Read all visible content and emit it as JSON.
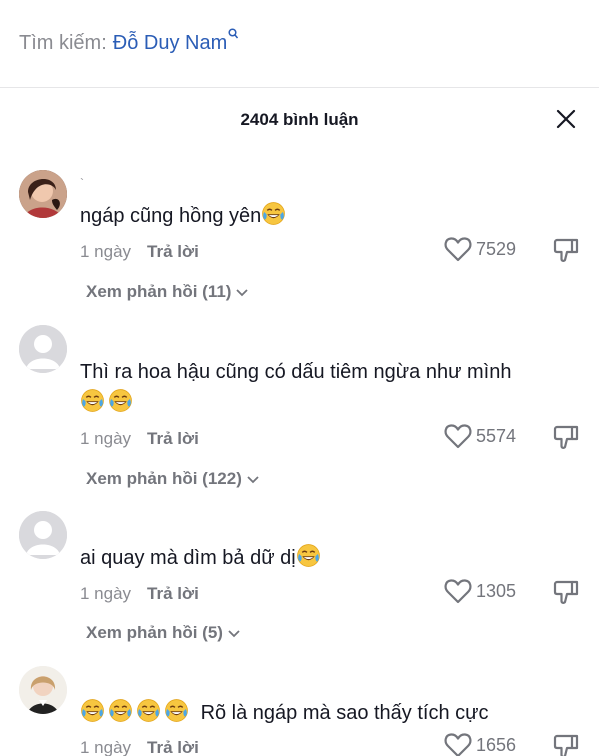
{
  "search": {
    "prefix": "Tìm kiếm:",
    "term": "Đỗ Duy Nam"
  },
  "header": {
    "title": "2404 bình luận"
  },
  "comments": [
    {
      "username": "`",
      "text": "ngáp cũng hồng yên",
      "time": "1 ngày",
      "reply_label": "Trả lời",
      "likes": "7529",
      "replies_label": "Xem phản hồi (11)"
    },
    {
      "username": "",
      "text_line1": "Thì ra hoa hậu cũng có dấu tiêm ngừa như mình",
      "time": "1 ngày",
      "reply_label": "Trả lời",
      "likes": "5574",
      "replies_label": "Xem phản hồi (122)"
    },
    {
      "username": "",
      "text": "ai quay mà dìm bả dữ dị",
      "time": "1 ngày",
      "reply_label": "Trả lời",
      "likes": "1305",
      "replies_label": "Xem phản hồi (5)"
    },
    {
      "username": "",
      "text": "Rõ là ngáp mà sao thấy tích cực",
      "time": "1 ngày",
      "reply_label": "Trả lời",
      "likes": "1656"
    }
  ],
  "icons": {
    "emoji": "laughing-crying-emoji",
    "heart": "heart-outline-icon",
    "dislike": "thumbs-down-icon",
    "close": "close-icon",
    "chevron": "chevron-down-icon"
  }
}
